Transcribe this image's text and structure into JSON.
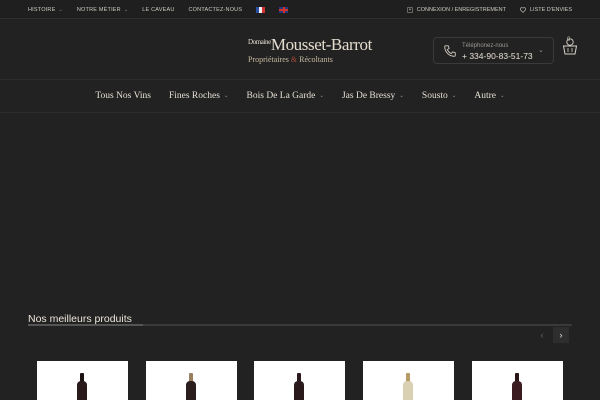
{
  "topbar": {
    "nav": [
      {
        "label": "HISTOIRE",
        "has_dropdown": true
      },
      {
        "label": "NOTRE MÉTIER",
        "has_dropdown": true
      },
      {
        "label": "LE CAVEAU",
        "has_dropdown": false
      },
      {
        "label": "CONTACTEZ-NOUS",
        "has_dropdown": false
      }
    ],
    "languages": [
      "fr-flag-icon",
      "uk-flag-icon"
    ],
    "account_label": "CONNEXION / ENREGISTREMENT",
    "wishlist_label": "LISTE D'ENVIES"
  },
  "header": {
    "logo_name_small": "Domaine",
    "logo_name": "Mousset-Barrot",
    "logo_sub_left": "Propriétaires",
    "logo_sub_amp": "&",
    "logo_sub_right": "Récoltants",
    "phone_label": "Téléphonez-nous",
    "phone_number": "+ 334-90-83-51-73",
    "cart_count": "0"
  },
  "main_nav": [
    {
      "label": "Tous Nos Vins",
      "has_dropdown": false
    },
    {
      "label": "Fines Roches",
      "has_dropdown": true
    },
    {
      "label": "Bois De La Garde",
      "has_dropdown": true
    },
    {
      "label": "Jas De Bressy",
      "has_dropdown": true
    },
    {
      "label": "Sousto",
      "has_dropdown": true
    },
    {
      "label": "Autre",
      "has_dropdown": true
    }
  ],
  "section": {
    "title": "Nos meilleurs produits",
    "prev_icon": "‹",
    "next_icon": "›"
  },
  "products": [
    {
      "bottle_color": "#2a1a1c",
      "neck_color": "#1c1214"
    },
    {
      "bottle_color": "#2b1c1d",
      "neck_color": "#9a7f5c"
    },
    {
      "bottle_color": "#2a1a1c",
      "neck_color": "#2a1a1c"
    },
    {
      "bottle_color": "#d9d0b2",
      "neck_color": "#b79b63"
    },
    {
      "bottle_color": "#3a1c20",
      "neck_color": "#2a1416"
    }
  ],
  "colors": {
    "background": "#222222",
    "accent": "#a84a3a"
  }
}
